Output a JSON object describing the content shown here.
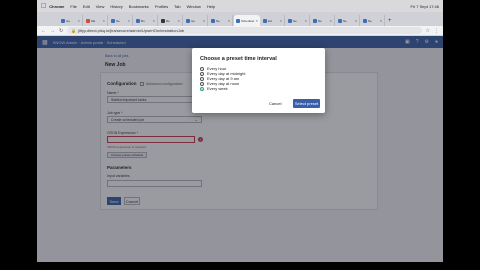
{
  "menubar": {
    "apple_icon": "apple-logo",
    "items": [
      "Chrome",
      "File",
      "Edit",
      "View",
      "History",
      "Bookmarks",
      "Profiles",
      "Tab",
      "Window",
      "Help"
    ],
    "status": "Fri 7 Sept 17:46"
  },
  "browser": {
    "tabs": [
      {
        "label": "Ge",
        "active": false
      },
      {
        "label": "Ma",
        "active": false
      },
      {
        "label": "Ne",
        "active": false
      },
      {
        "label": "Bu",
        "active": false
      },
      {
        "label": "Re",
        "active": false
      },
      {
        "label": "Ge",
        "active": false
      },
      {
        "label": "Ne",
        "active": false
      },
      {
        "label": "Scheduler",
        "active": true
      },
      {
        "label": "Ed",
        "active": false
      },
      {
        "label": "Ne",
        "active": false
      },
      {
        "label": "Ne",
        "active": false
      },
      {
        "label": "Ne",
        "active": false
      },
      {
        "label": "Ne",
        "active": false
      }
    ],
    "url": "jiltyy.direct.plsq.in/jira/secure/admin/UpsertOrchestrationJob"
  },
  "app": {
    "breadcrumb": "SNOW Admin · Admin portal · Scheduled",
    "back_link": "Back to all jobs",
    "page_title": "New Job",
    "configuration": {
      "heading": "Configuration",
      "toggle_label": "Advanced configuration",
      "name_label": "Name *",
      "name_value": "Stalled important tasks",
      "job_type_label": "Job type *",
      "job_type_value": "Create scheduled job",
      "cron_label": "CRON Expression *",
      "cron_error": "CRON expression is required",
      "preset_button": "Choose preset schedule"
    },
    "parameters": {
      "heading": "Parameters",
      "field_label": "Input variables"
    },
    "save_label": "Save",
    "cancel_label": "Cancel"
  },
  "modal": {
    "title": "Choose a preset time interval",
    "options": [
      {
        "label": "Every hour",
        "selected": false
      },
      {
        "label": "Every day at midnight",
        "selected": false
      },
      {
        "label": "Every day at 9 am",
        "selected": false
      },
      {
        "label": "Every day at noon",
        "selected": false
      },
      {
        "label": "Every week",
        "selected": true
      }
    ],
    "cancel_label": "Cancel",
    "select_label": "Select preset"
  },
  "colors": {
    "accent": "#3a5fa8",
    "error": "#c9374c",
    "selected_radio": "#2ca08c"
  }
}
